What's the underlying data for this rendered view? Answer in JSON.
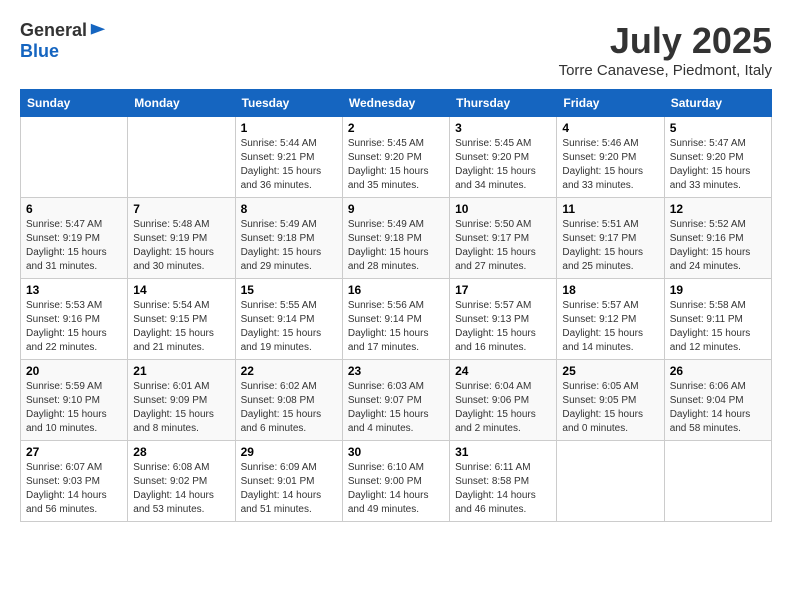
{
  "header": {
    "logo_line1": "General",
    "logo_line2": "Blue",
    "month_title": "July 2025",
    "location": "Torre Canavese, Piedmont, Italy"
  },
  "weekdays": [
    "Sunday",
    "Monday",
    "Tuesday",
    "Wednesday",
    "Thursday",
    "Friday",
    "Saturday"
  ],
  "weeks": [
    [
      {
        "day": "",
        "info": ""
      },
      {
        "day": "",
        "info": ""
      },
      {
        "day": "1",
        "info": "Sunrise: 5:44 AM\nSunset: 9:21 PM\nDaylight: 15 hours\nand 36 minutes."
      },
      {
        "day": "2",
        "info": "Sunrise: 5:45 AM\nSunset: 9:20 PM\nDaylight: 15 hours\nand 35 minutes."
      },
      {
        "day": "3",
        "info": "Sunrise: 5:45 AM\nSunset: 9:20 PM\nDaylight: 15 hours\nand 34 minutes."
      },
      {
        "day": "4",
        "info": "Sunrise: 5:46 AM\nSunset: 9:20 PM\nDaylight: 15 hours\nand 33 minutes."
      },
      {
        "day": "5",
        "info": "Sunrise: 5:47 AM\nSunset: 9:20 PM\nDaylight: 15 hours\nand 33 minutes."
      }
    ],
    [
      {
        "day": "6",
        "info": "Sunrise: 5:47 AM\nSunset: 9:19 PM\nDaylight: 15 hours\nand 31 minutes."
      },
      {
        "day": "7",
        "info": "Sunrise: 5:48 AM\nSunset: 9:19 PM\nDaylight: 15 hours\nand 30 minutes."
      },
      {
        "day": "8",
        "info": "Sunrise: 5:49 AM\nSunset: 9:18 PM\nDaylight: 15 hours\nand 29 minutes."
      },
      {
        "day": "9",
        "info": "Sunrise: 5:49 AM\nSunset: 9:18 PM\nDaylight: 15 hours\nand 28 minutes."
      },
      {
        "day": "10",
        "info": "Sunrise: 5:50 AM\nSunset: 9:17 PM\nDaylight: 15 hours\nand 27 minutes."
      },
      {
        "day": "11",
        "info": "Sunrise: 5:51 AM\nSunset: 9:17 PM\nDaylight: 15 hours\nand 25 minutes."
      },
      {
        "day": "12",
        "info": "Sunrise: 5:52 AM\nSunset: 9:16 PM\nDaylight: 15 hours\nand 24 minutes."
      }
    ],
    [
      {
        "day": "13",
        "info": "Sunrise: 5:53 AM\nSunset: 9:16 PM\nDaylight: 15 hours\nand 22 minutes."
      },
      {
        "day": "14",
        "info": "Sunrise: 5:54 AM\nSunset: 9:15 PM\nDaylight: 15 hours\nand 21 minutes."
      },
      {
        "day": "15",
        "info": "Sunrise: 5:55 AM\nSunset: 9:14 PM\nDaylight: 15 hours\nand 19 minutes."
      },
      {
        "day": "16",
        "info": "Sunrise: 5:56 AM\nSunset: 9:14 PM\nDaylight: 15 hours\nand 17 minutes."
      },
      {
        "day": "17",
        "info": "Sunrise: 5:57 AM\nSunset: 9:13 PM\nDaylight: 15 hours\nand 16 minutes."
      },
      {
        "day": "18",
        "info": "Sunrise: 5:57 AM\nSunset: 9:12 PM\nDaylight: 15 hours\nand 14 minutes."
      },
      {
        "day": "19",
        "info": "Sunrise: 5:58 AM\nSunset: 9:11 PM\nDaylight: 15 hours\nand 12 minutes."
      }
    ],
    [
      {
        "day": "20",
        "info": "Sunrise: 5:59 AM\nSunset: 9:10 PM\nDaylight: 15 hours\nand 10 minutes."
      },
      {
        "day": "21",
        "info": "Sunrise: 6:01 AM\nSunset: 9:09 PM\nDaylight: 15 hours\nand 8 minutes."
      },
      {
        "day": "22",
        "info": "Sunrise: 6:02 AM\nSunset: 9:08 PM\nDaylight: 15 hours\nand 6 minutes."
      },
      {
        "day": "23",
        "info": "Sunrise: 6:03 AM\nSunset: 9:07 PM\nDaylight: 15 hours\nand 4 minutes."
      },
      {
        "day": "24",
        "info": "Sunrise: 6:04 AM\nSunset: 9:06 PM\nDaylight: 15 hours\nand 2 minutes."
      },
      {
        "day": "25",
        "info": "Sunrise: 6:05 AM\nSunset: 9:05 PM\nDaylight: 15 hours\nand 0 minutes."
      },
      {
        "day": "26",
        "info": "Sunrise: 6:06 AM\nSunset: 9:04 PM\nDaylight: 14 hours\nand 58 minutes."
      }
    ],
    [
      {
        "day": "27",
        "info": "Sunrise: 6:07 AM\nSunset: 9:03 PM\nDaylight: 14 hours\nand 56 minutes."
      },
      {
        "day": "28",
        "info": "Sunrise: 6:08 AM\nSunset: 9:02 PM\nDaylight: 14 hours\nand 53 minutes."
      },
      {
        "day": "29",
        "info": "Sunrise: 6:09 AM\nSunset: 9:01 PM\nDaylight: 14 hours\nand 51 minutes."
      },
      {
        "day": "30",
        "info": "Sunrise: 6:10 AM\nSunset: 9:00 PM\nDaylight: 14 hours\nand 49 minutes."
      },
      {
        "day": "31",
        "info": "Sunrise: 6:11 AM\nSunset: 8:58 PM\nDaylight: 14 hours\nand 46 minutes."
      },
      {
        "day": "",
        "info": ""
      },
      {
        "day": "",
        "info": ""
      }
    ]
  ]
}
